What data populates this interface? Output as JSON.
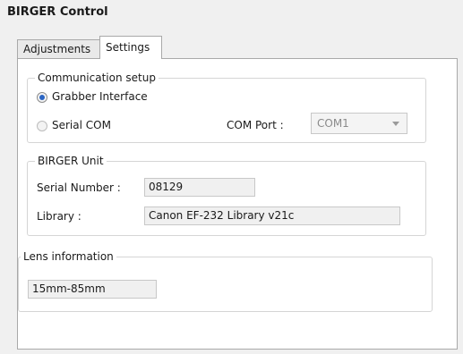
{
  "window": {
    "title": "BIRGER Control"
  },
  "tabs": [
    {
      "label": "Adjustments",
      "selected": false
    },
    {
      "label": "Settings",
      "selected": true
    }
  ],
  "communication": {
    "legend": "Communication setup",
    "options": [
      {
        "label": "Grabber Interface",
        "checked": true
      },
      {
        "label": "Serial COM",
        "checked": false
      }
    ],
    "com_port_label": "COM Port :",
    "com_port_value": "COM1"
  },
  "unit": {
    "legend": "BIRGER Unit",
    "serial_label": "Serial Number :",
    "serial_value": "08129",
    "library_label": "Library :",
    "library_value": "Canon EF-232 Library v21c"
  },
  "lens": {
    "legend": "Lens information",
    "value": "15mm-85mm"
  },
  "colors": {
    "accent": "#2b65c3",
    "panel": "#ffffff",
    "background": "#f0f0f0"
  }
}
